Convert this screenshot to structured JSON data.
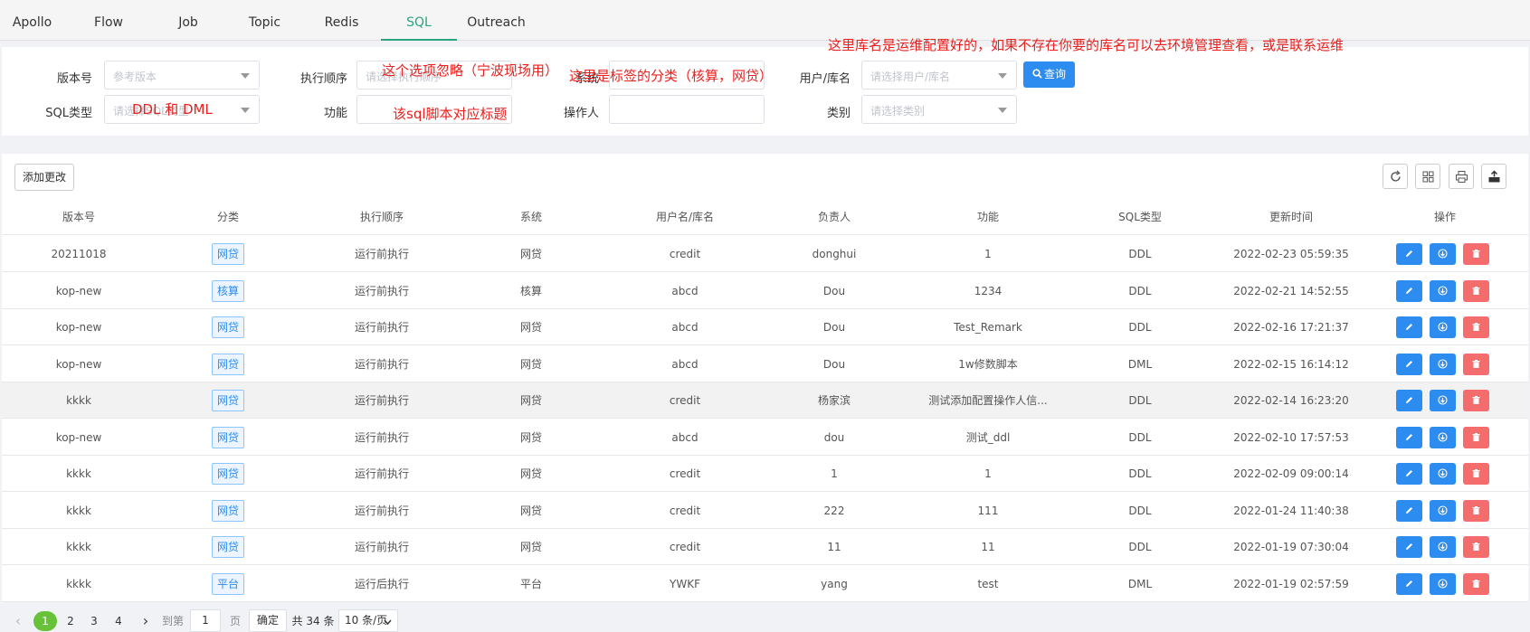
{
  "nav": {
    "tabs": [
      {
        "label": "Apollo"
      },
      {
        "label": "Flow"
      },
      {
        "label": "Job"
      },
      {
        "label": "Topic"
      },
      {
        "label": "Redis"
      },
      {
        "label": "SQL"
      },
      {
        "label": "Outreach"
      }
    ],
    "active_index": 5
  },
  "filters": {
    "version_label": "版本号",
    "version_placeholder": "参考版本",
    "order_label": "执行顺序",
    "order_placeholder": "请选择执行顺序",
    "system_label": "系统",
    "system_placeholder": "",
    "user_db_label": "用户/库名",
    "user_db_placeholder": "请选择用户/库名",
    "query_label": "查询",
    "sql_type_label": "SQL类型",
    "sql_type_placeholder": "请选择SQL类型",
    "function_label": "功能",
    "function_placeholder": "",
    "operator_label": "操作人",
    "operator_placeholder": "",
    "category_label": "类别",
    "category_placeholder": "请选择类别"
  },
  "annotations": {
    "db_note": "这里库名是运维配置好的，如果不存在你要的库名可以去环境管理查看，或是联系运维",
    "order_note": "这个选项忽略（宁波现场用）",
    "system_note": "这里是标签的分类（核算，网贷）",
    "sql_type_note": "DDL 和 DML",
    "function_note": "该sql脚本对应标题"
  },
  "table": {
    "add_label": "添加更改",
    "headers": [
      "版本号",
      "分类",
      "执行顺序",
      "系统",
      "用户名/库名",
      "负责人",
      "功能",
      "SQL类型",
      "更新时间",
      "操作"
    ],
    "rows": [
      {
        "version": "20211018",
        "category": "网贷",
        "order": "运行前执行",
        "system": "网贷",
        "user": "credit",
        "owner": "donghui",
        "function": "1",
        "sql_type": "DDL",
        "updated": "2022-02-23 05:59:35"
      },
      {
        "version": "kop-new",
        "category": "核算",
        "order": "运行前执行",
        "system": "核算",
        "user": "abcd",
        "owner": "Dou",
        "function": "1234",
        "sql_type": "DDL",
        "updated": "2022-02-21 14:52:55"
      },
      {
        "version": "kop-new",
        "category": "网贷",
        "order": "运行前执行",
        "system": "网贷",
        "user": "abcd",
        "owner": "Dou",
        "function": "Test_Remark",
        "sql_type": "DDL",
        "updated": "2022-02-16 17:21:37"
      },
      {
        "version": "kop-new",
        "category": "网贷",
        "order": "运行前执行",
        "system": "网贷",
        "user": "abcd",
        "owner": "Dou",
        "function": "1w修数脚本",
        "sql_type": "DML",
        "updated": "2022-02-15 16:14:12"
      },
      {
        "version": "kkkk",
        "category": "网贷",
        "order": "运行前执行",
        "system": "网贷",
        "user": "credit",
        "owner": "杨家滨",
        "function": "测试添加配置操作人信...",
        "sql_type": "DDL",
        "updated": "2022-02-14 16:23:20"
      },
      {
        "version": "kop-new",
        "category": "网贷",
        "order": "运行前执行",
        "system": "网贷",
        "user": "abcd",
        "owner": "dou",
        "function": "测试_ddl",
        "sql_type": "DDL",
        "updated": "2022-02-10 17:57:53"
      },
      {
        "version": "kkkk",
        "category": "网贷",
        "order": "运行前执行",
        "system": "网贷",
        "user": "credit",
        "owner": "1",
        "function": "1",
        "sql_type": "DDL",
        "updated": "2022-02-09 09:00:14"
      },
      {
        "version": "kkkk",
        "category": "网贷",
        "order": "运行前执行",
        "system": "网贷",
        "user": "credit",
        "owner": "222",
        "function": "111",
        "sql_type": "DDL",
        "updated": "2022-01-24 11:40:38"
      },
      {
        "version": "kkkk",
        "category": "网贷",
        "order": "运行前执行",
        "system": "网贷",
        "user": "credit",
        "owner": "11",
        "function": "11",
        "sql_type": "DDL",
        "updated": "2022-01-19 07:30:04"
      },
      {
        "version": "kkkk",
        "category": "平台",
        "order": "运行后执行",
        "system": "平台",
        "user": "YWKF",
        "owner": "yang",
        "function": "test",
        "sql_type": "DML",
        "updated": "2022-01-19 02:57:59"
      }
    ]
  },
  "pagination": {
    "prev": "‹",
    "next": "›",
    "pages": [
      "1",
      "2",
      "3",
      "4"
    ],
    "current": "1",
    "goto_label": "到第",
    "goto_value": "1",
    "page_unit": "页",
    "confirm_label": "确定",
    "total": "共 34 条",
    "page_size": "10 条/页"
  },
  "colors": {
    "accent": "#2aa57a",
    "primary": "#2d8cf0",
    "danger": "#f56c6c",
    "annotation": "#e8211f",
    "current_page": "#67c23a"
  }
}
